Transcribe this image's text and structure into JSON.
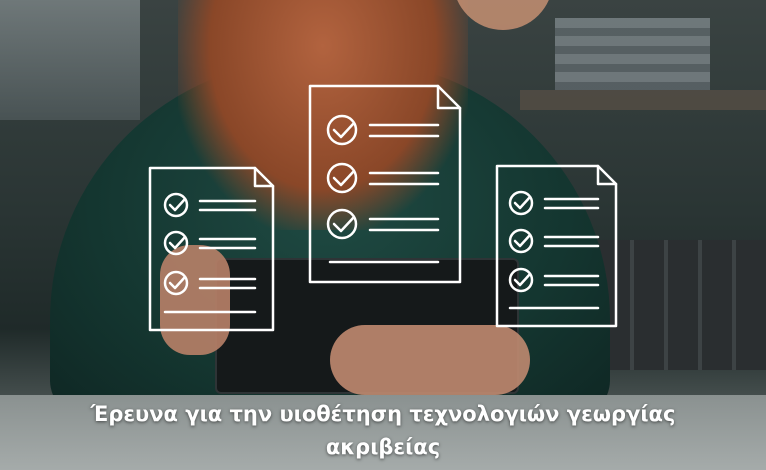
{
  "caption": {
    "line1": "Έρευνα για την  υιοθέτηση τεχνολογιών γεωργίας",
    "line2": "ακριβείας"
  },
  "illustration": {
    "subject": "woman holding tablet",
    "overlay_icon": "checklist-document-icon",
    "overlay_count": 3,
    "overlay_color": "#ffffff"
  }
}
